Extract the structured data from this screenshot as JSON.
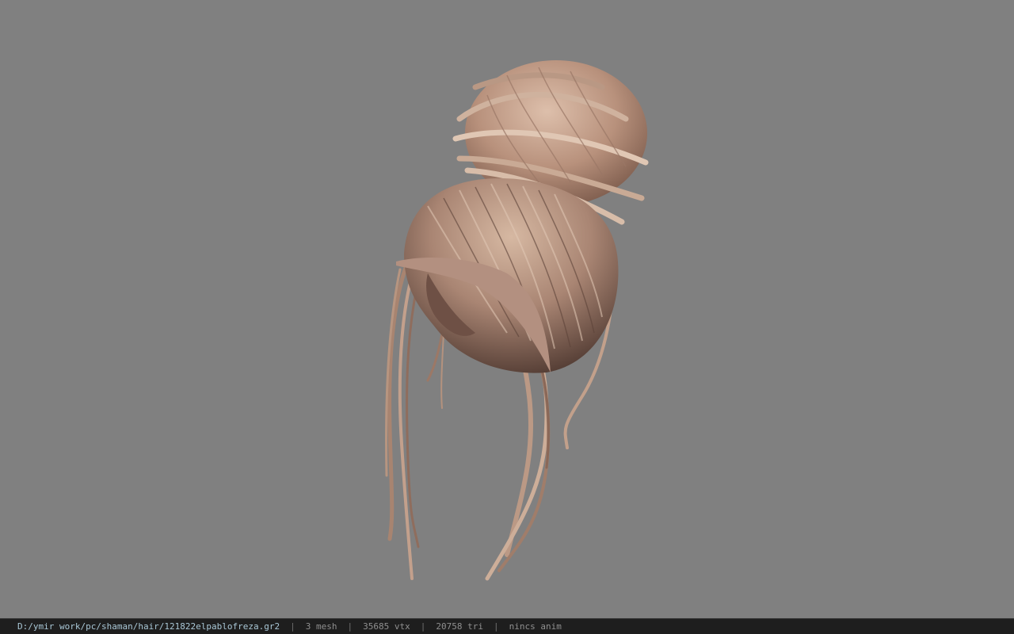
{
  "viewer": {
    "background_color": "#808080",
    "model": {
      "icon": "hair-bun-mesh",
      "primary_color": "#b08a76",
      "highlight_color": "#dcbfa8",
      "shadow_color": "#5e4237"
    }
  },
  "statusbar": {
    "file_path": "D:/ymir work/pc/shaman/hair/121822elpablofreza.gr2",
    "separator": "|",
    "mesh_count": "3 mesh",
    "vertex_count": "35685 vtx",
    "triangle_count": "20758 tri",
    "anim_status": "nincs anim"
  }
}
